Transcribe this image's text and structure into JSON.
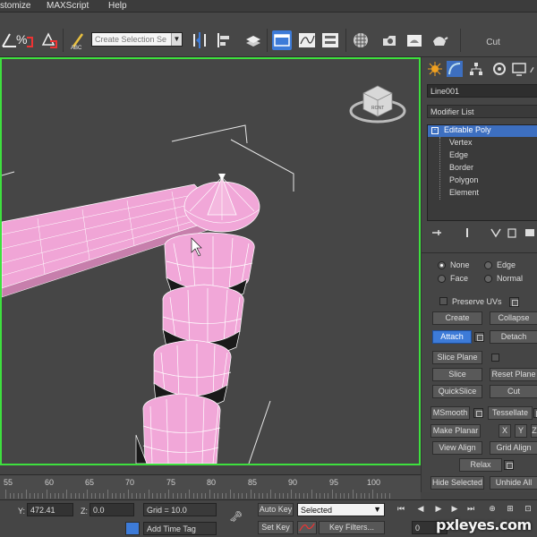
{
  "menubar": {
    "items": [
      "stomize",
      "MAXScript",
      "Help"
    ]
  },
  "toolbar": {
    "selection_set_placeholder": "Create Selection Se",
    "cut_label": "Cut",
    "icons": [
      "percent-snap-icon",
      "spinner-snap-icon",
      "edit-named-selection-icon",
      "mirror-icon",
      "align-icon",
      "layer-manager-icon",
      "graphite-ribbon-icon",
      "curve-editor-icon",
      "schematic-view-icon",
      "material-editor-icon",
      "render-setup-icon",
      "rendered-frame-icon",
      "render-icon"
    ]
  },
  "viewport": {
    "viewcube_label": "RONT",
    "accent": "#3ee03e",
    "mesh_color": "#f0a0d0"
  },
  "command_panel": {
    "object_name": "Line001",
    "modifier_list": "Modifier List",
    "stack": {
      "top": "Editable Poly",
      "toggle": "-",
      "subobjects": [
        "Vertex",
        "Edge",
        "Border",
        "Polygon",
        "Element"
      ]
    },
    "radios": [
      {
        "label": "None",
        "on": true
      },
      {
        "label": "Edge",
        "on": false
      },
      {
        "label": "Face",
        "on": false
      },
      {
        "label": "Normal",
        "on": false
      }
    ],
    "preserve_uvs": "Preserve UVs",
    "split": "Split",
    "buttons": {
      "create": "Create",
      "collapse": "Collapse",
      "attach": "Attach",
      "detach": "Detach",
      "slice_plane": "Slice Plane",
      "slice": "Slice",
      "reset_plane": "Reset Plane",
      "quickslice": "QuickSlice",
      "cut": "Cut",
      "msmooth": "MSmooth",
      "tessellate": "Tessellate",
      "make_planar": "Make Planar",
      "x": "X",
      "y": "Y",
      "z": "Z",
      "view_align": "View Align",
      "grid_align": "Grid Align",
      "relax": "Relax",
      "hide_selected": "Hide Selected",
      "unhide_all": "Unhide All"
    }
  },
  "timeline": {
    "ticks": [
      "55",
      "60",
      "65",
      "70",
      "75",
      "80",
      "85",
      "90",
      "95",
      "100"
    ]
  },
  "statusbar": {
    "y_label": "Y:",
    "y_value": "472.41",
    "z_label": "Z:",
    "z_value": "0.0",
    "grid": "Grid = 10.0",
    "add_time_tag": "Add Time Tag",
    "auto_key": "Auto Key",
    "set_key": "Set Key",
    "selected": "Selected",
    "key_filters": "Key Filters...",
    "frame_value": "0"
  },
  "watermark": "pxleyes.com"
}
